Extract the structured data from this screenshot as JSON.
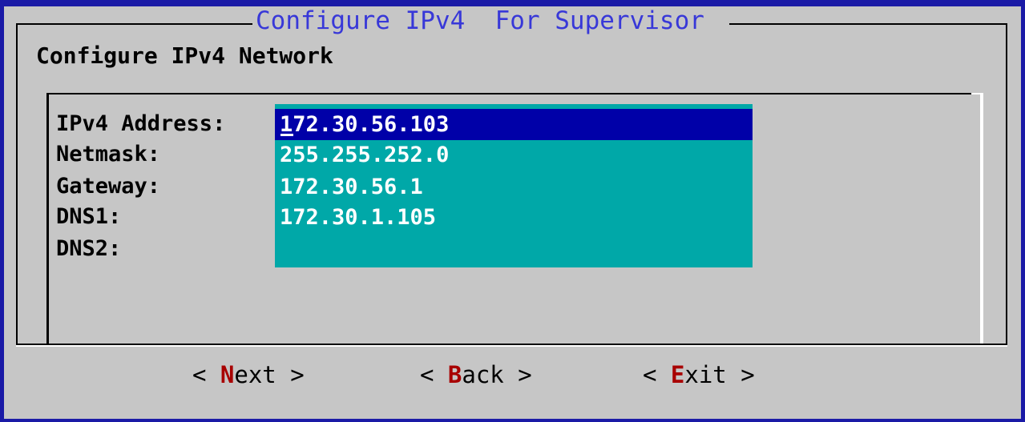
{
  "dialog": {
    "title": "Configure IPv4  For Supervisor",
    "subtitle": "Configure IPv4 Network"
  },
  "fields": [
    {
      "label": "IPv4 Address:",
      "value": "172.30.56.103",
      "focused": true
    },
    {
      "label": "Netmask:",
      "value": "255.255.252.0",
      "focused": false
    },
    {
      "label": "Gateway:",
      "value": "172.30.56.1",
      "focused": false
    },
    {
      "label": "DNS1:",
      "value": "172.30.1.105",
      "focused": false
    },
    {
      "label": "DNS2:",
      "value": "",
      "focused": false
    }
  ],
  "buttons": [
    {
      "open": "< ",
      "hotkey": "N",
      "rest": "ext",
      "close": " >"
    },
    {
      "open": "< ",
      "hotkey": "B",
      "rest": "ack",
      "close": " >"
    },
    {
      "open": "< ",
      "hotkey": "E",
      "rest": "xit",
      "close": " >"
    }
  ],
  "colors": {
    "screen_background": "#1a1aa6",
    "dialog_background": "#c6c6c6",
    "title_text": "#3838d8",
    "field_background": "#00a8a8",
    "focused_field_background": "#0000a8",
    "field_text": "#ffffff",
    "hotkey": "#a80000"
  }
}
